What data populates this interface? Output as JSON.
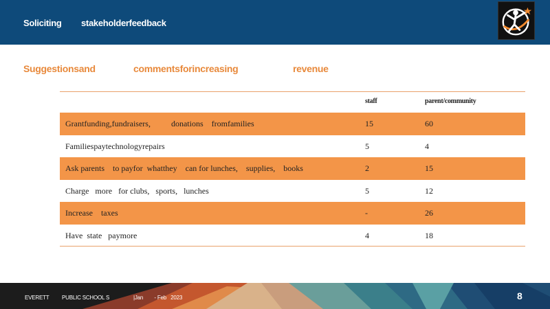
{
  "header": {
    "title_part1": "Soliciting",
    "title_part2": "stakeholderfeedback"
  },
  "logo": {
    "icon": "school-district-logo",
    "colors": [
      "#ffffff",
      "#f28a2e",
      "#111111"
    ]
  },
  "subtitle": {
    "part1": "Suggestionsand",
    "part2": "commentsforincreasing",
    "part3": "revenue"
  },
  "table": {
    "columns": [
      "",
      "staff",
      "parent/community"
    ],
    "rows": [
      {
        "label": "Grantfunding,fundraisers,          donations    fromfamilies",
        "staff": "15",
        "parent": "60",
        "shaded": true
      },
      {
        "label": "Familiespaytechnologyrepairs",
        "staff": "5",
        "parent": "4",
        "shaded": false
      },
      {
        "label": "Ask parents    to payfor  whatthey    can for lunches,    supplies,    books",
        "staff": "2",
        "parent": "15",
        "shaded": true
      },
      {
        "label": "Charge   more   for clubs,   sports,   lunches",
        "staff": "5",
        "parent": "12",
        "shaded": false
      },
      {
        "label": "Increase    taxes",
        "staff": "-",
        "parent": "26",
        "shaded": true
      },
      {
        "label": "Have  state   paymore",
        "staff": "4",
        "parent": "18",
        "shaded": false
      }
    ]
  },
  "footer": {
    "org1": "EVERETT",
    "org2": "PUBLIC SCHOOL S",
    "date": "|Jan        - Feb   2023",
    "page": "8"
  },
  "colors": {
    "header_bg": "#0e4a7a",
    "accent": "#f39548",
    "subtitle": "#e8893b"
  }
}
